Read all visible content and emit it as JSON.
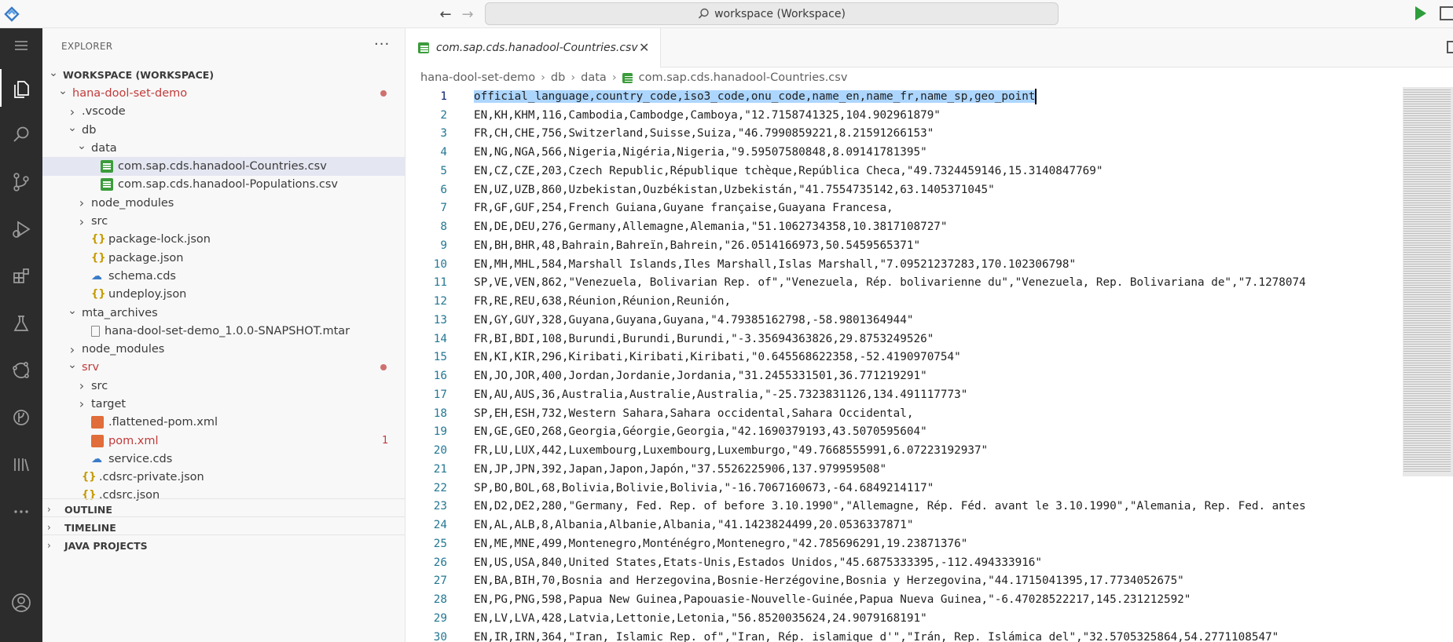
{
  "command_center": {
    "text": "workspace (Workspace)"
  },
  "colors": {
    "activity_bar": "#2c2c2c",
    "selection": "#add6ff",
    "git_modified": "#c13b3b",
    "run": "#2e9d3c"
  },
  "activity_bar": [
    "explorer-icon",
    "search-icon",
    "source-control-icon",
    "run-debug-icon",
    "extensions-icon",
    "testing-icon",
    "remote-icon",
    "timeline-icon",
    "library-icon",
    "more-icon",
    "account-icon",
    "settings-icon"
  ],
  "sidebar": {
    "header": "EXPLORER",
    "more": "···",
    "tree": [
      {
        "label": "WORKSPACE (WORKSPACE)",
        "indent": 0,
        "type": "root"
      },
      {
        "label": "hana-dool-set-demo",
        "indent": 1,
        "type": "folder-open",
        "git": true,
        "dot": true
      },
      {
        "label": ".vscode",
        "indent": 2,
        "type": "folder"
      },
      {
        "label": "db",
        "indent": 2,
        "type": "folder-open"
      },
      {
        "label": "data",
        "indent": 3,
        "type": "folder-open"
      },
      {
        "label": "com.sap.cds.hanadool-Countries.csv",
        "indent": 4,
        "type": "csv",
        "selected": true
      },
      {
        "label": "com.sap.cds.hanadool-Populations.csv",
        "indent": 4,
        "type": "csv"
      },
      {
        "label": "node_modules",
        "indent": 3,
        "type": "folder"
      },
      {
        "label": "src",
        "indent": 3,
        "type": "folder"
      },
      {
        "label": "package-lock.json",
        "indent": 3,
        "type": "json"
      },
      {
        "label": "package.json",
        "indent": 3,
        "type": "json"
      },
      {
        "label": "schema.cds",
        "indent": 3,
        "type": "cds"
      },
      {
        "label": "undeploy.json",
        "indent": 3,
        "type": "json"
      },
      {
        "label": "mta_archives",
        "indent": 2,
        "type": "folder-open"
      },
      {
        "label": "hana-dool-set-demo_1.0.0-SNAPSHOT.mtar",
        "indent": 3,
        "type": "file"
      },
      {
        "label": "node_modules",
        "indent": 2,
        "type": "folder"
      },
      {
        "label": "srv",
        "indent": 2,
        "type": "folder-open",
        "git": true,
        "dot": true
      },
      {
        "label": "src",
        "indent": 3,
        "type": "folder"
      },
      {
        "label": "target",
        "indent": 3,
        "type": "folder"
      },
      {
        "label": ".flattened-pom.xml",
        "indent": 3,
        "type": "xml"
      },
      {
        "label": "pom.xml",
        "indent": 3,
        "type": "xml",
        "git": true,
        "count": "1"
      },
      {
        "label": "service.cds",
        "indent": 3,
        "type": "cds"
      },
      {
        "label": ".cdsrc-private.json",
        "indent": 2,
        "type": "json"
      },
      {
        "label": ".cdsrc.json",
        "indent": 2,
        "type": "json"
      }
    ],
    "sections": [
      "OUTLINE",
      "TIMELINE",
      "JAVA PROJECTS"
    ]
  },
  "editor": {
    "tab_label": "com.sap.cds.hanadool-Countries.csv",
    "breadcrumb": [
      "hana-dool-set-demo",
      "db",
      "data",
      "com.sap.cds.hanadool-Countries.csv"
    ],
    "lines": [
      "official_language,country_code,iso3_code,onu_code,name_en,name_fr,name_sp,geo_point",
      "EN,KH,KHM,116,Cambodia,Cambodge,Camboya,\"12.7158741325,104.902961879\"",
      "FR,CH,CHE,756,Switzerland,Suisse,Suiza,\"46.7990859221,8.21591266153\"",
      "EN,NG,NGA,566,Nigeria,Nigéria,Nigeria,\"9.59507580848,8.09141781395\"",
      "EN,CZ,CZE,203,Czech Republic,République tchèque,República Checa,\"49.7324459146,15.3140847769\"",
      "EN,UZ,UZB,860,Uzbekistan,Ouzbékistan,Uzbekistán,\"41.7554735142,63.1405371045\"",
      "FR,GF,GUF,254,French Guiana,Guyane française,Guayana Francesa,",
      "EN,DE,DEU,276,Germany,Allemagne,Alemania,\"51.1062734358,10.3817108727\"",
      "EN,BH,BHR,48,Bahrain,Bahreïn,Bahrein,\"26.0514166973,50.5459565371\"",
      "EN,MH,MHL,584,Marshall Islands,Iles Marshall,Islas Marshall,\"7.09521237283,170.102306798\"",
      "SP,VE,VEN,862,\"Venezuela, Bolivarian Rep. of\",\"Venezuela, Rép. bolivarienne du\",\"Venezuela, Rep. Bolivariana de\",\"7.1278074",
      "FR,RE,REU,638,Réunion,Réunion,Reunión,",
      "EN,GY,GUY,328,Guyana,Guyana,Guyana,\"4.79385162798,-58.9801364944\"",
      "FR,BI,BDI,108,Burundi,Burundi,Burundi,\"-3.35694363826,29.8753249526\"",
      "EN,KI,KIR,296,Kiribati,Kiribati,Kiribati,\"0.645568622358,-52.4190970754\"",
      "EN,JO,JOR,400,Jordan,Jordanie,Jordania,\"31.2455331501,36.771219291\"",
      "EN,AU,AUS,36,Australia,Australie,Australia,\"-25.7323831126,134.491117773\"",
      "SP,EH,ESH,732,Western Sahara,Sahara occidental,Sahara Occidental,",
      "EN,GE,GEO,268,Georgia,Géorgie,Georgia,\"42.1690379193,43.5070595604\"",
      "FR,LU,LUX,442,Luxembourg,Luxembourg,Luxemburgo,\"49.7668555991,6.07223192937\"",
      "EN,JP,JPN,392,Japan,Japon,Japón,\"37.5526225906,137.979959508\"",
      "SP,BO,BOL,68,Bolivia,Bolivie,Bolivia,\"-16.7067160673,-64.6849214117\"",
      "EN,D2,DE2,280,\"Germany, Fed. Rep. of before 3.10.1990\",\"Allemagne, Rép. Féd. avant le 3.10.1990\",\"Alemania, Rep. Fed. antes",
      "EN,AL,ALB,8,Albania,Albanie,Albania,\"41.1423824499,20.0536337871\"",
      "EN,ME,MNE,499,Montenegro,Monténégro,Montenegro,\"42.785696291,19.23871376\"",
      "EN,US,USA,840,United States,Etats-Unis,Estados Unidos,\"45.6875333395,-112.494333916\"",
      "EN,BA,BIH,70,Bosnia and Herzegovina,Bosnie-Herzégovine,Bosnia y Herzegovina,\"44.1715041395,17.7734052675\"",
      "EN,PG,PNG,598,Papua New Guinea,Papouasie-Nouvelle-Guinée,Papua Nueva Guinea,\"-6.47028522217,145.231212592\"",
      "EN,LV,LVA,428,Latvia,Lettonie,Letonia,\"56.8520035624,24.9079168191\"",
      "EN,IR,IRN,364,\"Iran, Islamic Rep. of\",\"Iran, Rép. islamique d'\",\"Irán, Rep. Islámica del\",\"32.5705325864,54.2771108547\""
    ]
  }
}
